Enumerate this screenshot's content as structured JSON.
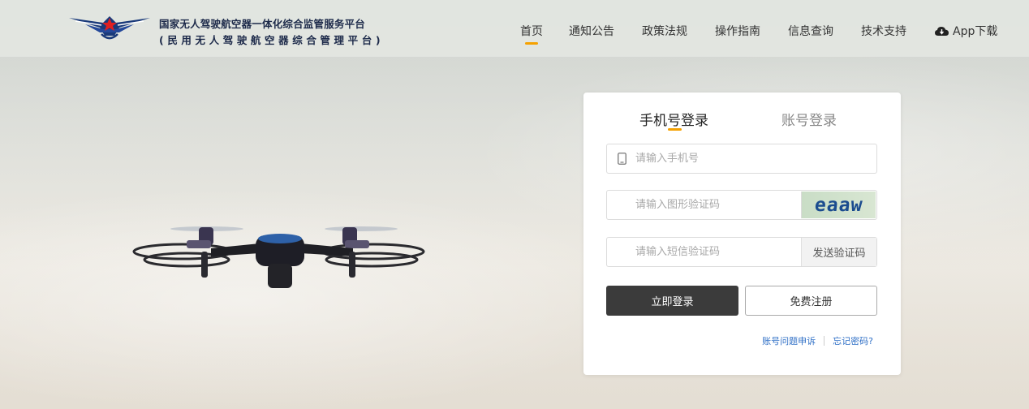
{
  "header": {
    "brand_line1": "国家无人驾驶航空器一体化综合监管服务平台",
    "brand_line2": "(民用无人驾驶航空器综合管理平台)",
    "nav": [
      {
        "label": "首页",
        "active": true
      },
      {
        "label": "通知公告"
      },
      {
        "label": "政策法规"
      },
      {
        "label": "操作指南"
      },
      {
        "label": "信息查询"
      },
      {
        "label": "技术支持"
      }
    ],
    "app_download": "App下载",
    "accent_color": "#f5a100"
  },
  "login": {
    "tab_phone": "手机号登录",
    "tab_account": "账号登录",
    "phone_placeholder": "请输入手机号",
    "captcha_placeholder": "请输入图形验证码",
    "captcha_text": "eaaw",
    "sms_placeholder": "请输入短信验证码",
    "send_code": "发送验证码",
    "login_button": "立即登录",
    "register_button": "免费注册",
    "appeal_link": "账号问题申诉",
    "forgot_link": "忘记密码?"
  }
}
